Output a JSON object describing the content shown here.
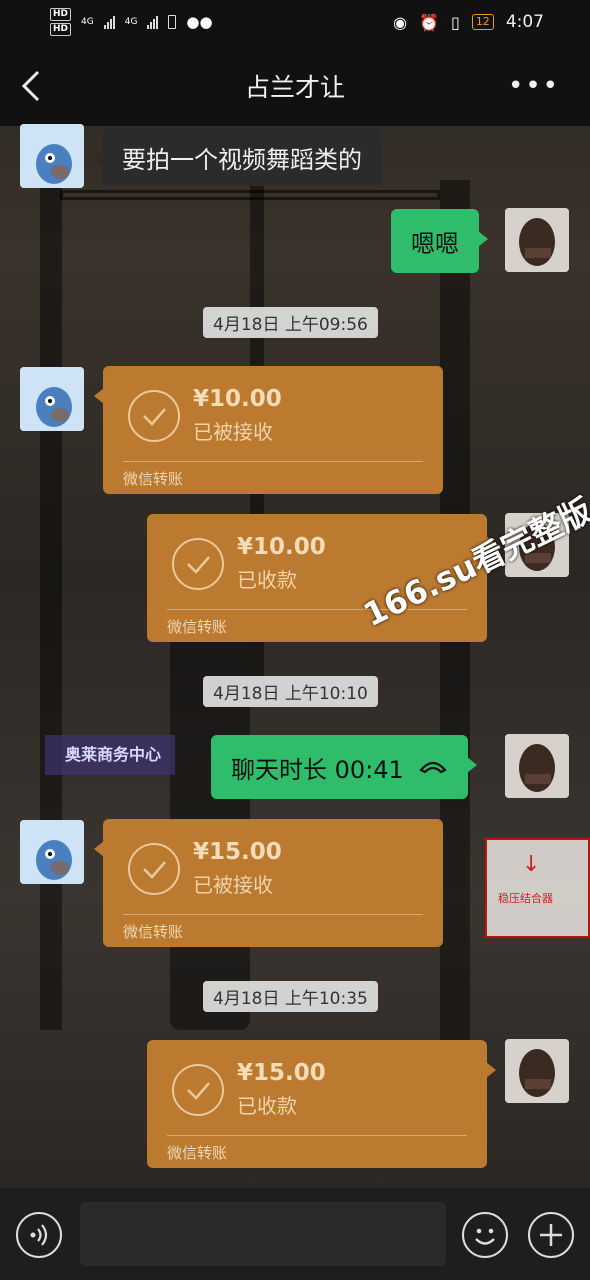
{
  "status_bar": {
    "network_1": "HD",
    "network_2": "HD",
    "sig1_label": "4G",
    "sig2_label": "4G",
    "battery": "12",
    "time": "4:07"
  },
  "header": {
    "title": "占兰才让",
    "more_label": "•••"
  },
  "messages": {
    "m1_text": "要拍一个视频舞蹈类的",
    "m2_text": "嗯嗯",
    "ts1": "4月18日 上午09:56",
    "t1_amount": "¥10.00",
    "t1_status": "已被接收",
    "t1_footer": "微信转账",
    "t2_amount": "¥10.00",
    "t2_status": "已收款",
    "t2_footer": "微信转账",
    "ts2": "4月18日 上午10:10",
    "call_text": "聊天时长 00:41",
    "t3_amount": "¥15.00",
    "t3_status": "已被接收",
    "t3_footer": "微信转账",
    "ts3": "4月18日 上午10:35",
    "t4_amount": "¥15.00",
    "t4_status": "已收款",
    "t4_footer": "微信转账"
  },
  "background": {
    "sign_text": "奥莱商务中心",
    "box_text": "稳压结合器"
  },
  "watermark": "166.su看完整版",
  "colors": {
    "transfer": "#bb7a30",
    "green_bubble": "#2fbd6c",
    "dark_bubble": "#2b2b2b"
  }
}
